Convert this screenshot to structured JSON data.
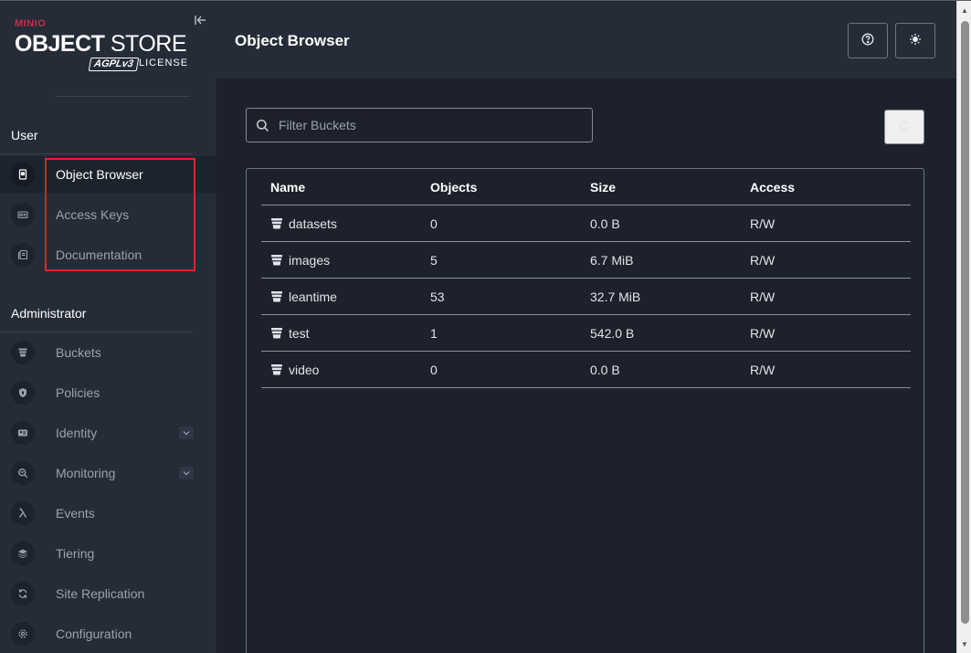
{
  "branding": {
    "brand": "MINIO",
    "title_bold": "OBJECT",
    "title_rest": " STORE",
    "agpl": "AGPLv3",
    "license": "LICENSE"
  },
  "header": {
    "title": "Object Browser"
  },
  "sidebar": {
    "user_section": "User",
    "admin_section": "Administrator",
    "user_items": [
      {
        "label": "Object Browser",
        "icon": "object-browser-icon",
        "active": true
      },
      {
        "label": "Access Keys",
        "icon": "access-keys-icon"
      },
      {
        "label": "Documentation",
        "icon": "documentation-icon"
      }
    ],
    "admin_items": [
      {
        "label": "Buckets",
        "icon": "bucket-icon"
      },
      {
        "label": "Policies",
        "icon": "policy-icon"
      },
      {
        "label": "Identity",
        "icon": "identity-icon",
        "expandable": true
      },
      {
        "label": "Monitoring",
        "icon": "monitoring-icon",
        "expandable": true
      },
      {
        "label": "Events",
        "icon": "lambda-icon"
      },
      {
        "label": "Tiering",
        "icon": "tiering-icon"
      },
      {
        "label": "Site Replication",
        "icon": "replication-icon"
      },
      {
        "label": "Configuration",
        "icon": "gear-icon"
      }
    ]
  },
  "filter": {
    "placeholder": "Filter Buckets"
  },
  "table": {
    "columns": [
      "Name",
      "Objects",
      "Size",
      "Access"
    ],
    "rows": [
      {
        "name": "datasets",
        "objects": "0",
        "size": "0.0 B",
        "access": "R/W"
      },
      {
        "name": "images",
        "objects": "5",
        "size": "6.7 MiB",
        "access": "R/W"
      },
      {
        "name": "leantime",
        "objects": "53",
        "size": "32.7 MiB",
        "access": "R/W"
      },
      {
        "name": "test",
        "objects": "1",
        "size": "542.0 B",
        "access": "R/W"
      },
      {
        "name": "video",
        "objects": "0",
        "size": "0.0 B",
        "access": "R/W"
      }
    ]
  },
  "colors": {
    "sidebar_bg": "#252c38",
    "main_bg": "#1c212b",
    "brand_red": "#c72c48",
    "highlight": "#e8202f"
  }
}
